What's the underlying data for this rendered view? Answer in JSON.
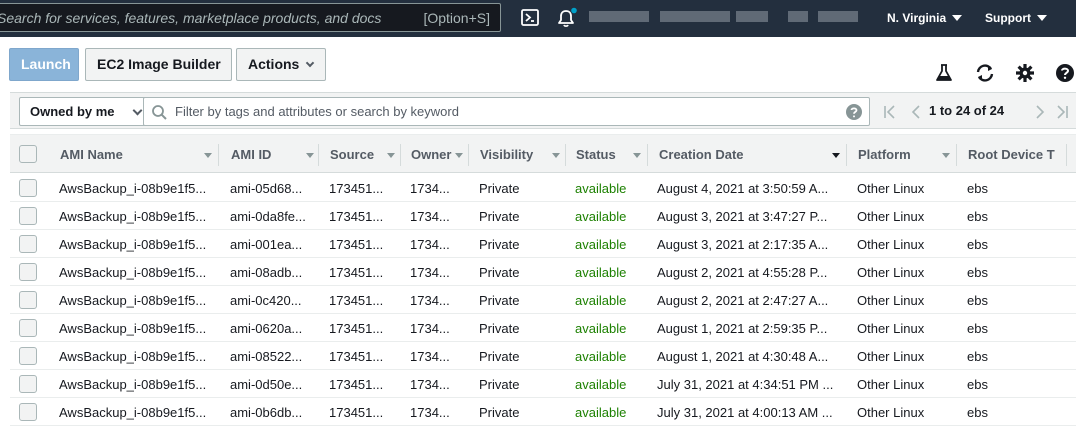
{
  "topnav": {
    "search_placeholder": "Search for services, features, marketplace products, and docs",
    "search_shortcut": "[Option+S]",
    "region": "N. Virginia",
    "support": "Support"
  },
  "toolbar": {
    "launch": "Launch",
    "image_builder": "EC2 Image Builder",
    "actions": "Actions"
  },
  "filter": {
    "owned": "Owned by me",
    "placeholder": "Filter by tags and attributes or search by keyword",
    "pagination": "1 to 24 of 24"
  },
  "table": {
    "columns": [
      "AMI Name",
      "AMI ID",
      "Source",
      "Owner",
      "Visibility",
      "Status",
      "Creation Date",
      "Platform",
      "Root Device T"
    ],
    "rows": [
      [
        "AwsBackup_i-08b9e1f5...",
        "ami-05d68...",
        "173451...",
        "1734...",
        "Private",
        "available",
        "August 4, 2021 at 3:50:59 A...",
        "Other Linux",
        "ebs"
      ],
      [
        "AwsBackup_i-08b9e1f5...",
        "ami-0da8fe...",
        "173451...",
        "1734...",
        "Private",
        "available",
        "August 3, 2021 at 3:47:27 P...",
        "Other Linux",
        "ebs"
      ],
      [
        "AwsBackup_i-08b9e1f5...",
        "ami-001ea...",
        "173451...",
        "1734...",
        "Private",
        "available",
        "August 3, 2021 at 2:17:35 A...",
        "Other Linux",
        "ebs"
      ],
      [
        "AwsBackup_i-08b9e1f5...",
        "ami-08adb...",
        "173451...",
        "1734...",
        "Private",
        "available",
        "August 2, 2021 at 4:55:28 P...",
        "Other Linux",
        "ebs"
      ],
      [
        "AwsBackup_i-08b9e1f5...",
        "ami-0c420...",
        "173451...",
        "1734...",
        "Private",
        "available",
        "August 2, 2021 at 2:47:27 A...",
        "Other Linux",
        "ebs"
      ],
      [
        "AwsBackup_i-08b9e1f5...",
        "ami-0620a...",
        "173451...",
        "1734...",
        "Private",
        "available",
        "August 1, 2021 at 2:59:35 P...",
        "Other Linux",
        "ebs"
      ],
      [
        "AwsBackup_i-08b9e1f5...",
        "ami-08522...",
        "173451...",
        "1734...",
        "Private",
        "available",
        "August 1, 2021 at 4:30:48 A...",
        "Other Linux",
        "ebs"
      ],
      [
        "AwsBackup_i-08b9e1f5...",
        "ami-0d50e...",
        "173451...",
        "1734...",
        "Private",
        "available",
        "July 31, 2021 at 4:34:51 PM ...",
        "Other Linux",
        "ebs"
      ],
      [
        "AwsBackup_i-08b9e1f5...",
        "ami-0b6db...",
        "173451...",
        "1734...",
        "Private",
        "available",
        "July 31, 2021 at 4:00:13 AM ...",
        "Other Linux",
        "ebs"
      ]
    ]
  },
  "colors": {
    "nav_bg": "#232f3e",
    "primary_button": "#8ab4d9",
    "available": "#1d8102",
    "notification_dot": "#00a1c9"
  },
  "icons": [
    "cloudshell-icon",
    "bell-icon",
    "flask-icon",
    "refresh-icon",
    "gear-icon",
    "help-icon",
    "search-icon",
    "first-page-icon",
    "prev-page-icon",
    "next-page-icon",
    "last-page-icon"
  ]
}
